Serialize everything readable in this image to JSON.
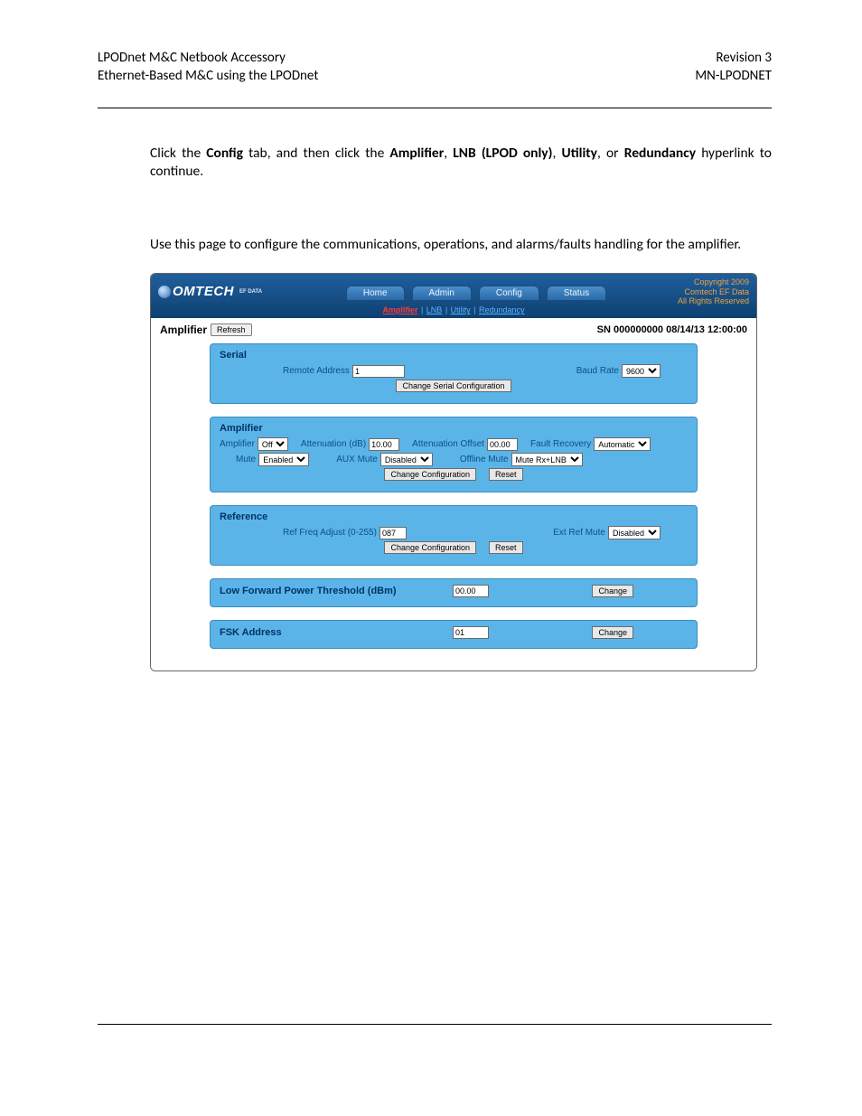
{
  "header": {
    "left_line1": "LPODnet M&C Netbook Accessory",
    "left_line2": "Ethernet-Based M&C using the LPODnet",
    "right_line1": "Revision 3",
    "right_line2": "MN-LPODNET"
  },
  "intro1": {
    "prefix": "Click the ",
    "config": "Config",
    "mid1": " tab, and then click the ",
    "amp": "Amplifier",
    "c1": ", ",
    "lnb": "LNB (LPOD only)",
    "c2": ", ",
    "util": "Utility",
    "c3": ", or ",
    "red": "Redundancy",
    "suffix": " hyperlink to continue."
  },
  "intro2": "Use this page to configure the communications, operations, and alarms/faults handling for the amplifier.",
  "ui": {
    "logo_main": "OMTECH",
    "logo_sub": "EF DATA",
    "tabs": {
      "home": "Home",
      "admin": "Admin",
      "config": "Config",
      "status": "Status"
    },
    "subtabs": {
      "amplifier": "Amplifier",
      "lnb": "LNB",
      "utility": "Utility",
      "redundancy": "Redundancy"
    },
    "copyright": {
      "l1": "Copyright 2009",
      "l2": "Comtech EF Data",
      "l3": "All Rights Reserved"
    },
    "amp_bar": {
      "title": "Amplifier",
      "refresh": "Refresh",
      "sn": "SN 000000000 08/14/13 12:00:00"
    },
    "serial": {
      "title": "Serial",
      "remote_address_lbl": "Remote Address",
      "remote_address_val": "1",
      "baud_lbl": "Baud Rate",
      "baud_val": "9600",
      "change_btn": "Change Serial Configuration"
    },
    "amplifier": {
      "title": "Amplifier",
      "amp_lbl": "Amplifier",
      "amp_val": "Off",
      "atten_lbl": "Attenuation (dB)",
      "atten_val": "10.00",
      "attoff_lbl": "Attenuation Offset",
      "attoff_val": "00.00",
      "fault_lbl": "Fault Recovery",
      "fault_val": "Automatic",
      "mute_lbl": "Mute",
      "mute_val": "Enabled",
      "aux_lbl": "AUX Mute",
      "aux_val": "Disabled",
      "off_lbl": "Offline Mute",
      "off_val": "Mute Rx+LNB",
      "change_btn": "Change Configuration",
      "reset_btn": "Reset"
    },
    "reference": {
      "title": "Reference",
      "adj_lbl": "Ref Freq Adjust (0-255)",
      "adj_val": "087",
      "ext_lbl": "Ext Ref Mute",
      "ext_val": "Disabled",
      "change_btn": "Change Configuration",
      "reset_btn": "Reset"
    },
    "lfpt": {
      "title": "Low Forward Power Threshold (dBm)",
      "val": "00.00",
      "change_btn": "Change"
    },
    "fsk": {
      "title": "FSK Address",
      "val": "01",
      "change_btn": "Change"
    }
  }
}
